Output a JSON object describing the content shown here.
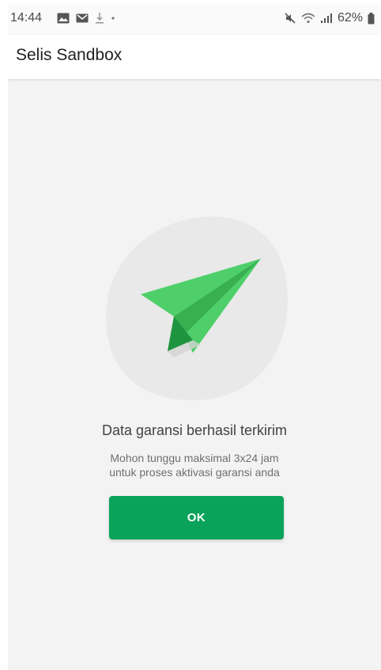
{
  "statusbar": {
    "time": "14:44",
    "battery": "62%",
    "icons_left": [
      "gallery-icon",
      "gmail-icon",
      "download-icon",
      "dot-icon"
    ],
    "icons_right": [
      "mute-icon",
      "wifi-icon",
      "signal-icon",
      "battery-icon"
    ]
  },
  "appbar": {
    "title": "Selis Sandbox"
  },
  "message": {
    "title": "Data garansi berhasil terkirim",
    "body_line1": "Mohon tunggu maksimal 3x24 jam",
    "body_line2": "untuk proses aktivasi garansi anda"
  },
  "actions": {
    "ok_label": "OK"
  },
  "colors": {
    "accent": "#0aa35a",
    "plane_light": "#4fcf6a",
    "plane_mid": "#38b052",
    "plane_dark": "#1f9440",
    "blob": "#e9e9e9"
  }
}
